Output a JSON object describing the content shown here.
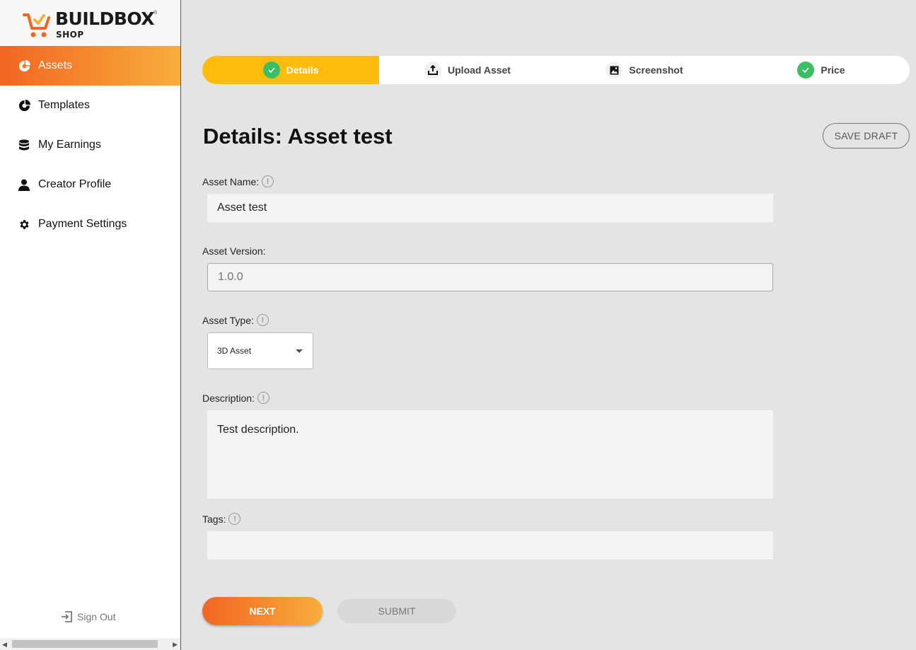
{
  "brand": {
    "name": "BUILDBOX",
    "sub": "SHOP",
    "tm": "®",
    "accent": "#f26522"
  },
  "sidebar": {
    "items": [
      {
        "label": "Assets",
        "icon": "pie-chart-icon",
        "active": true
      },
      {
        "label": "Templates",
        "icon": "pie-chart-icon",
        "active": false
      },
      {
        "label": "My Earnings",
        "icon": "database-icon",
        "active": false
      },
      {
        "label": "Creator Profile",
        "icon": "user-icon",
        "active": false
      },
      {
        "label": "Payment Settings",
        "icon": "gear-icon",
        "active": false
      }
    ],
    "signout_label": "Sign Out"
  },
  "stepper": {
    "steps": [
      {
        "label": "Details",
        "icon": "check-icon",
        "active": true
      },
      {
        "label": "Upload Asset",
        "icon": "upload-icon",
        "active": false
      },
      {
        "label": "Screenshot",
        "icon": "image-icon",
        "active": false
      },
      {
        "label": "Price",
        "icon": "check-icon",
        "active": false
      }
    ]
  },
  "page": {
    "title": "Details: Asset test",
    "save_draft_label": "SAVE DRAFT"
  },
  "form": {
    "asset_name": {
      "label": "Asset Name:",
      "value": "Asset test"
    },
    "asset_version": {
      "label": "Asset Version:",
      "placeholder": "1.0.0"
    },
    "asset_type": {
      "label": "Asset Type:",
      "value": "3D Asset"
    },
    "description": {
      "label": "Description:",
      "value": "Test description."
    },
    "tags": {
      "label": "Tags:",
      "value": ""
    },
    "info_glyph": "!"
  },
  "actions": {
    "next_label": "NEXT",
    "submit_label": "SUBMIT"
  }
}
